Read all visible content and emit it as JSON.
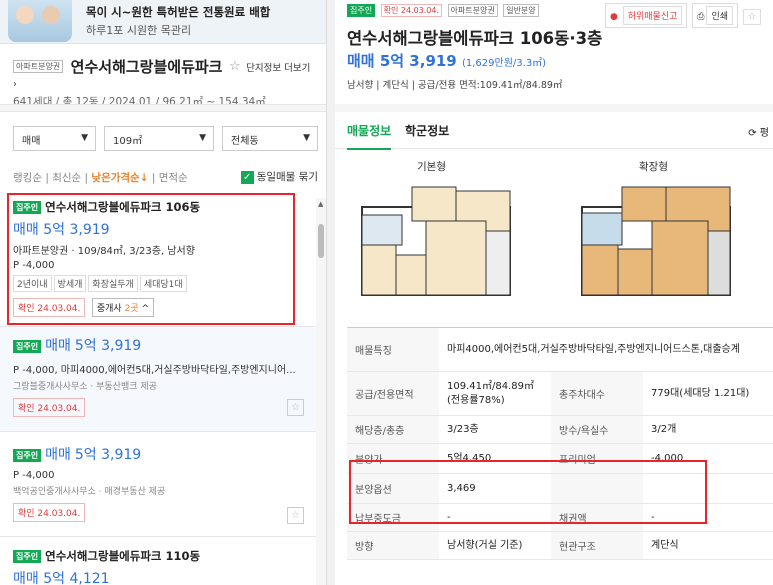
{
  "ad": {
    "line1": "목이 시~원한 특허받은 전통원료 배합",
    "line2": "하루1포 시원한 목관리"
  },
  "complex": {
    "badge": "아파트분양권",
    "name": "연수서해그랑블에듀파크",
    "info_link": "단지정보 더보기 ›",
    "summary": "641세대 / 총 12동 / 2024.01 / 96.21㎡ ~ 154.34㎡"
  },
  "filters": {
    "trade": "매매",
    "area": "109㎡",
    "dong": "전체동"
  },
  "sort": {
    "options": [
      "랭킹순",
      "최신순",
      "낮은가격순↓",
      "면적순"
    ],
    "active_index": 2,
    "dup_label": "동일매물 묶기"
  },
  "listings": [
    {
      "badge": "집주인",
      "title": "연수서해그랑블에듀파크 106동",
      "price_label": "매매",
      "price": "5억 3,919",
      "spec": "아파트분양권 · 109/84㎡, 3/23층, 남서향",
      "premium": "P -4,000",
      "tags": [
        "2년이내",
        "방세개",
        "화장실두개",
        "세대당1대"
      ],
      "confirmed": "확인 24.03.04.",
      "broker_label": "중개사",
      "broker_count": "2곳",
      "broker_suffix": "^"
    },
    {
      "badge": "집주인",
      "price_label": "매매",
      "price": "5억 3,919",
      "desc": "P -4,000, 마피4000,에어컨5대,거실주방바닥타일,주방엔지니어...",
      "agent": "그랑블중개사사무소 · 부동산뱅크 제공",
      "confirmed": "확인 24.03.04."
    },
    {
      "badge": "집주인",
      "price_label": "매매",
      "price": "5억 3,919",
      "desc": "P -4,000",
      "agent": "백억공인중개사사무소 · 매경부동산 제공",
      "confirmed": "확인 24.03.04."
    },
    {
      "badge": "집주인",
      "title": "연수서해그랑블에듀파크 110동",
      "price_label": "매매",
      "price": "5억 4,121"
    }
  ],
  "detail": {
    "badges": [
      "집주인",
      "확인 24.03.04.",
      "아파트분양권",
      "일반분양"
    ],
    "tools": {
      "report": "허위매물신고",
      "print": "인쇄",
      "star": "☆"
    },
    "title": "연수서해그랑블에듀파크 106동·3층",
    "price_label": "매매",
    "price": "5억 3,919",
    "price_per": "(1,629만원/3.3㎡)",
    "meta": "남서향 | 계단식 | 공급/전용 면적:109.41㎡/84.89㎡",
    "tabs": [
      "매물정보",
      "학군정보"
    ],
    "refresh": "⟳ 평",
    "floorplans": [
      "기본형",
      "확장형"
    ],
    "rows": [
      {
        "k": "매물특징",
        "v": "마피4000,에어컨5대,거실주방바닥타일,주방엔지니어드스톤,대출승계"
      },
      {
        "k": "공급/전용면적",
        "v": "109.41㎡/84.89㎡(전용률78%)",
        "k2": "총주차대수",
        "v2": "779대(세대당 1.21대)"
      },
      {
        "k": "해당층/총층",
        "v": "3/23층",
        "k2": "방수/욕실수",
        "v2": "3/2개"
      },
      {
        "k": "분양가",
        "v": "5억4,450",
        "k2": "프리미엄",
        "v2": "-4,000"
      },
      {
        "k": "분양옵션",
        "v": "3,469",
        "k2": "",
        "v2": ""
      },
      {
        "k": "납부중도금",
        "v": "-",
        "k2": "채권액",
        "v2": "-"
      },
      {
        "k": "방향",
        "v": "남서향(거실 기준)",
        "k2": "현관구조",
        "v2": "계단식"
      }
    ]
  },
  "colors": {
    "accent": "#2f72d8",
    "brand": "#13a854",
    "highlight": "#e6262b",
    "sort_active": "#e7842c"
  }
}
